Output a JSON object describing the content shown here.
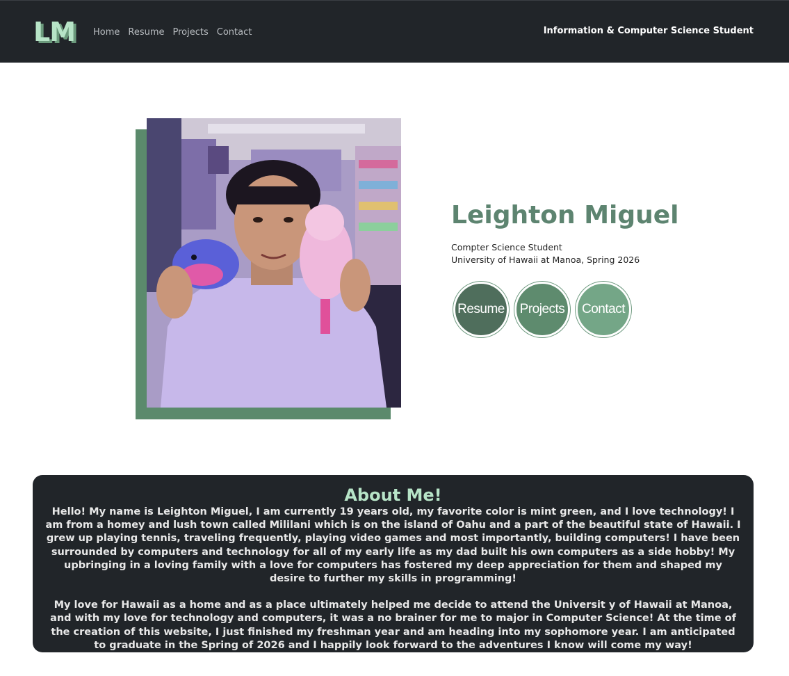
{
  "navbar": {
    "brand": "LM",
    "links": [
      "Home",
      "Resume",
      "Projects",
      "Contact"
    ],
    "tagline": "Information & Computer Science Student"
  },
  "hero": {
    "name": "Leighton Miguel",
    "subtitle_line1": "Compter Science Student",
    "subtitle_line2": "University of Hawaii at Manoa, Spring 2026",
    "buttons": [
      "Resume",
      "Projects",
      "Contact"
    ]
  },
  "about": {
    "title": "About Me!",
    "paragraph1": "Hello! My name is Leighton Miguel, I am currently 19 years old, my favorite color is mint green, and I love technology! I am from a homey and lush town called Mililani which is on the island of Oahu and a part of the beautiful state of Hawaii. I grew up playing tennis, traveling frequently, playing video games and most importantly, building computers! I have been surrounded by computers and technology for all of my early life as my dad built his own computers as a side hobby! My upbringing in a loving family with a love for computers has fostered my deep appreciation for them and shaped my desire to further my skills in programming!",
    "paragraph2": "My love for Hawaii as a home and as a place ultimately helped me decide to attend the Universit y of Hawaii at Manoa, and with my love for technology and computers, it was a no brainer for me to major in Computer Science! At the time of the creation of this website, I just finished my freshman year and am heading into my sophomore year. I am anticipated to graduate in the Spring of 2026 and I happily look forward to the adventures I know will come my way!"
  },
  "colors": {
    "navbar_bg": "#212529",
    "mint": "#b7e4c7",
    "accent_green": "#5d8470"
  }
}
